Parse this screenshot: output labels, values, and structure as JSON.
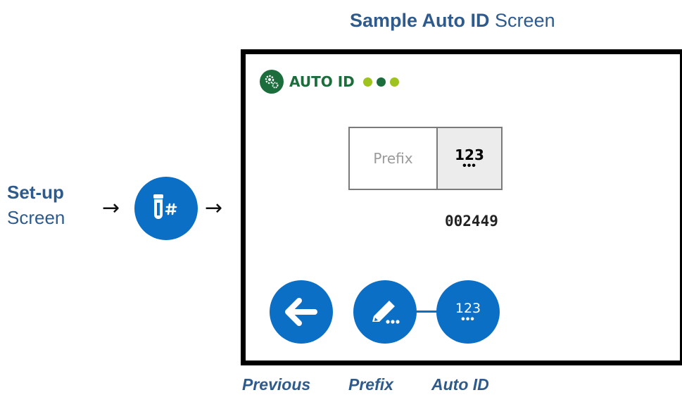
{
  "heading": {
    "bold": "Sample Auto ID",
    "rest": "Screen"
  },
  "setup": {
    "bold": "Set-up",
    "rest": "Screen"
  },
  "arrows": {
    "left": "→",
    "right": "→"
  },
  "device": {
    "title": "AUTO ID",
    "prefix_label": "Prefix",
    "number_label": "123",
    "number_dots": "•••",
    "counter": "002449",
    "auto_id_button_label": "123",
    "auto_id_button_dots": "•••"
  },
  "captions": {
    "previous": "Previous",
    "prefix": "Prefix",
    "auto_id": "Auto ID"
  },
  "colors": {
    "blue": "#0b6fc6",
    "green": "#1b6e3c",
    "lime": "#9ec21e",
    "text_blue": "#2f5b8c"
  },
  "icons": [
    "tube-hash-icon",
    "gear-icon",
    "back-arrow-icon",
    "pencil-icon"
  ]
}
